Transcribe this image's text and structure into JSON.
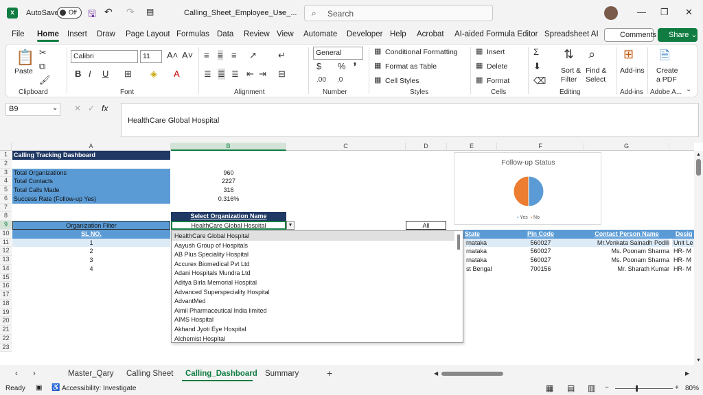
{
  "titlebar": {
    "autosave": "AutoSave",
    "toggle": "Off",
    "filename": "Calling_Sheet_Employee_Use_...",
    "search_placeholder": "Search"
  },
  "menu": {
    "items": [
      "File",
      "Home",
      "Insert",
      "Draw",
      "Page Layout",
      "Formulas",
      "Data",
      "Review",
      "View",
      "Automate",
      "Developer",
      "Help",
      "Acrobat",
      "AI-aided Formula Editor",
      "Spreadsheet AI"
    ],
    "comments": "Comments",
    "share": "Share"
  },
  "ribbon": {
    "paste": "Paste",
    "font_name": "Calibri",
    "font_size": "11",
    "number_format": "General",
    "cond_format": "Conditional Formatting",
    "format_table": "Format as Table",
    "cell_styles": "Cell Styles",
    "insert": "Insert",
    "delete": "Delete",
    "format": "Format",
    "sort_filter": "Sort &",
    "sort_filter2": "Filter",
    "find_select": "Find &",
    "find_select2": "Select",
    "addins": "Add-ins",
    "create_pdf": "Create",
    "create_pdf2": "a PDF",
    "groups": [
      "Clipboard",
      "Font",
      "Alignment",
      "Number",
      "Styles",
      "Cells",
      "Editing",
      "Add-ins",
      "Adobe A..."
    ]
  },
  "formula_bar": {
    "name_box": "B9",
    "content": "HealthCare Global Hospital"
  },
  "columns": [
    "A",
    "B",
    "C",
    "D",
    "E",
    "F",
    "G"
  ],
  "rows": [
    "1",
    "2",
    "3",
    "4",
    "5",
    "6",
    "7",
    "8",
    "9",
    "10",
    "11",
    "12",
    "13",
    "14",
    "15",
    "16",
    "17",
    "18",
    "19",
    "20",
    "21",
    "22",
    "23"
  ],
  "dashboard": {
    "title": "Calling Tracking Dashboard",
    "labels": [
      "Total Organizations",
      "Total Contacts",
      "Total Calls Made",
      "Success Rate (Follow-up Yes)"
    ],
    "values": [
      "960",
      "2227",
      "316",
      "0.316%"
    ],
    "select_label": "Select Organization Name",
    "org_filter": "Organization Filter",
    "selected_org": "HealthCare Global Hospital",
    "all": "All",
    "sl_header": "SL NO.",
    "sl": [
      "1",
      "2",
      "3",
      "4"
    ],
    "table_headers": {
      "state": "State",
      "pin": "Pin Code",
      "contact": "Contact Person Name",
      "desig": "Desig"
    },
    "table_rows": [
      {
        "state": "rnataka",
        "pin": "560027",
        "contact": "Mr.Venkata Sainadh Podili",
        "desig": "Unit Le"
      },
      {
        "state": "rnataka",
        "pin": "560027",
        "contact": "Ms. Poonam Sharma",
        "desig": "HR- M"
      },
      {
        "state": "rnataka",
        "pin": "560027",
        "contact": "Ms. Poonam Sharma",
        "desig": "HR- M"
      },
      {
        "state": "st Bengal",
        "pin": "700156",
        "contact": "Mr. Sharath Kumar",
        "desig": "HR- M"
      }
    ]
  },
  "chart_data": {
    "type": "pie",
    "title": "Follow-up Status",
    "categories": [
      "Yes",
      "No"
    ],
    "values": [
      50,
      50
    ],
    "colors": [
      "#5b9bd5",
      "#ed7d31"
    ],
    "legend": "bottom"
  },
  "dropdown_options": [
    "HealthCare Global Hospital",
    "Aayush Group of Hospitals",
    "AB Plus Speciality Hospital",
    "Accurex Biomedical Pvt Ltd",
    "Adani Hospitals Mundra Ltd",
    "Aditya Birla Memorial Hospital",
    "Advanced Superspeciality Hospital",
    "AdvantMed",
    "Aimil Pharmaceutical India limited",
    "AIMS Hospital",
    "Akhand Jyoti Eye Hospital",
    "Alchemist Hospital"
  ],
  "sheets": [
    "Master_Qary",
    "Calling Sheet",
    "Calling_Dashboard",
    "Summary"
  ],
  "status": {
    "ready": "Ready",
    "accessibility": "Accessibility: Investigate",
    "zoom": "80%"
  }
}
